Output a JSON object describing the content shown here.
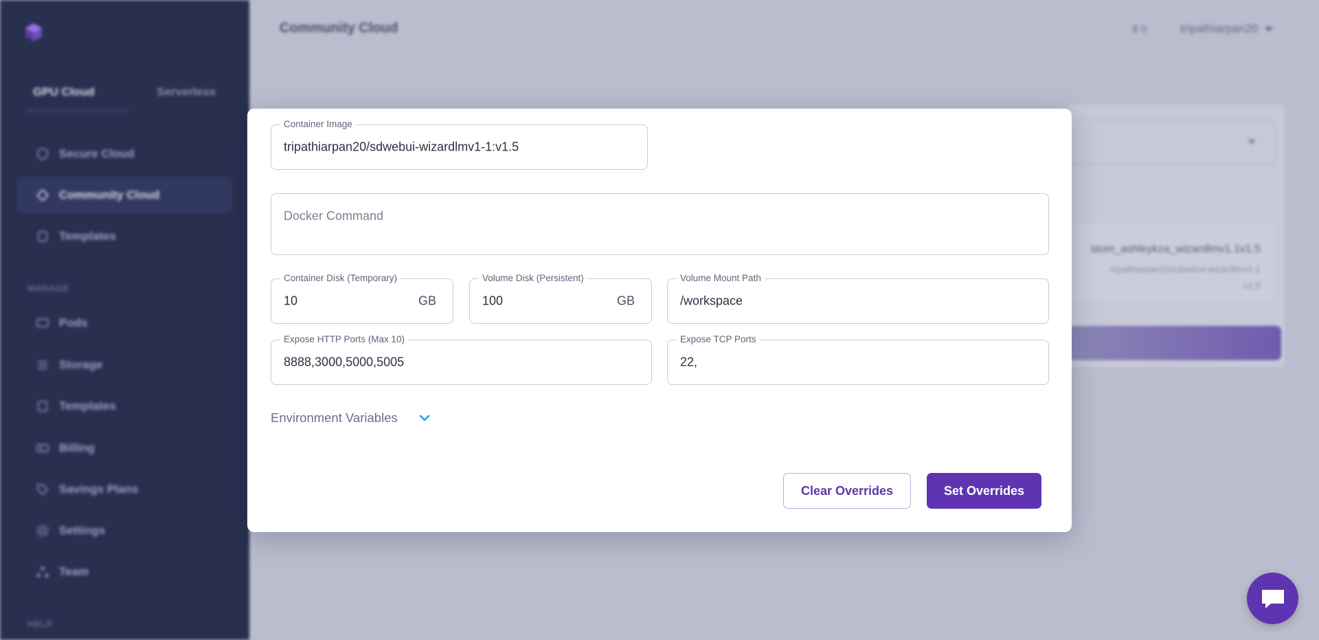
{
  "sidebar": {
    "tabs": {
      "gpu_cloud": "GPU Cloud",
      "serverless": "Serverless"
    },
    "items": [
      {
        "label": "Secure Cloud",
        "icon": "shield-icon"
      },
      {
        "label": "Community Cloud",
        "icon": "community-icon",
        "active": true
      },
      {
        "label": "Templates",
        "icon": "template-icon"
      }
    ],
    "manage_label": "MANAGE",
    "manage_items": [
      {
        "label": "Pods",
        "icon": "pods-icon"
      },
      {
        "label": "Storage",
        "icon": "storage-icon"
      },
      {
        "label": "Templates",
        "icon": "template-icon"
      },
      {
        "label": "Billing",
        "icon": "billing-icon"
      },
      {
        "label": "Savings Plans",
        "icon": "tag-icon"
      },
      {
        "label": "Settings",
        "icon": "gear-icon"
      },
      {
        "label": "Team",
        "icon": "team-icon"
      }
    ],
    "help_label": "HELP"
  },
  "header": {
    "title": "Community Cloud",
    "balance": "$ 0",
    "username": "tripathiarpan20"
  },
  "background_panel": {
    "template_name": "stom_ashleykza_wizardlmv1.1v1.5",
    "template_image_line1": "tripathiarpan20/sdwebui-wizardlmv1-1",
    "template_image_line2": ":v1.5"
  },
  "modal": {
    "container_image": {
      "label": "Container Image",
      "value": "tripathiarpan20/sdwebui-wizardlmv1-1:v1.5"
    },
    "docker_command": {
      "placeholder": "Docker Command"
    },
    "container_disk": {
      "label": "Container Disk (Temporary)",
      "value": "10",
      "unit": "GB"
    },
    "volume_disk": {
      "label": "Volume Disk (Persistent)",
      "value": "100",
      "unit": "GB"
    },
    "volume_mount_path": {
      "label": "Volume Mount Path",
      "value": "/workspace"
    },
    "http_ports": {
      "label": "Expose HTTP Ports (Max 10)",
      "value": "8888,3000,5000,5005"
    },
    "tcp_ports": {
      "label": "Expose TCP Ports",
      "value": "22,"
    },
    "env_vars_label": "Environment Variables",
    "clear_button": "Clear Overrides",
    "set_button": "Set Overrides"
  },
  "colors": {
    "accent": "#5e34b3",
    "sidebar_bg": "#141a3b",
    "chevron": "#1aa3d9"
  }
}
